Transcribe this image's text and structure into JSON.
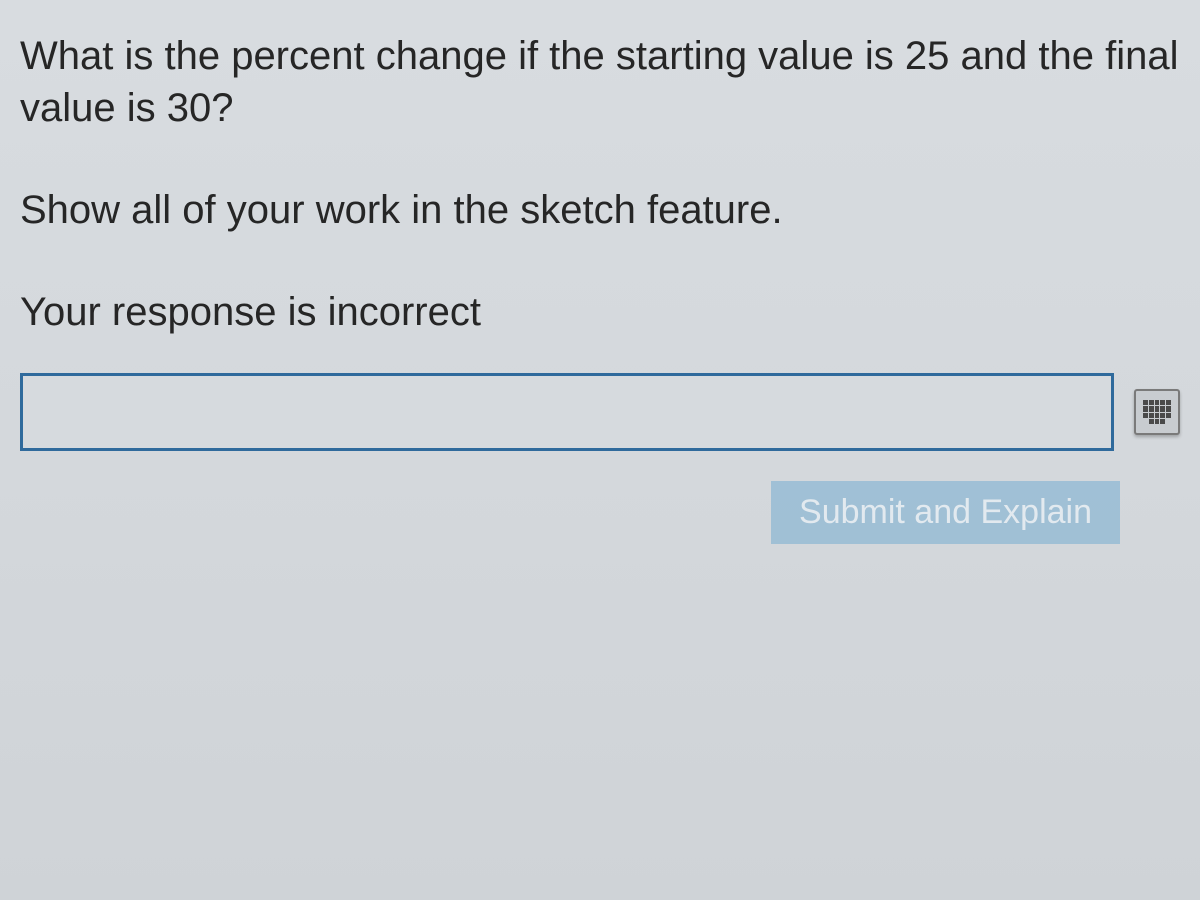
{
  "question": {
    "prompt": "What is the percent change if the starting value is 25 and the final value is 30?",
    "instruction": "Show all of your work in the sketch feature.",
    "feedback": "Your response is incorrect"
  },
  "input": {
    "value": "",
    "placeholder": ""
  },
  "buttons": {
    "submit_label": "Submit and Explain"
  }
}
